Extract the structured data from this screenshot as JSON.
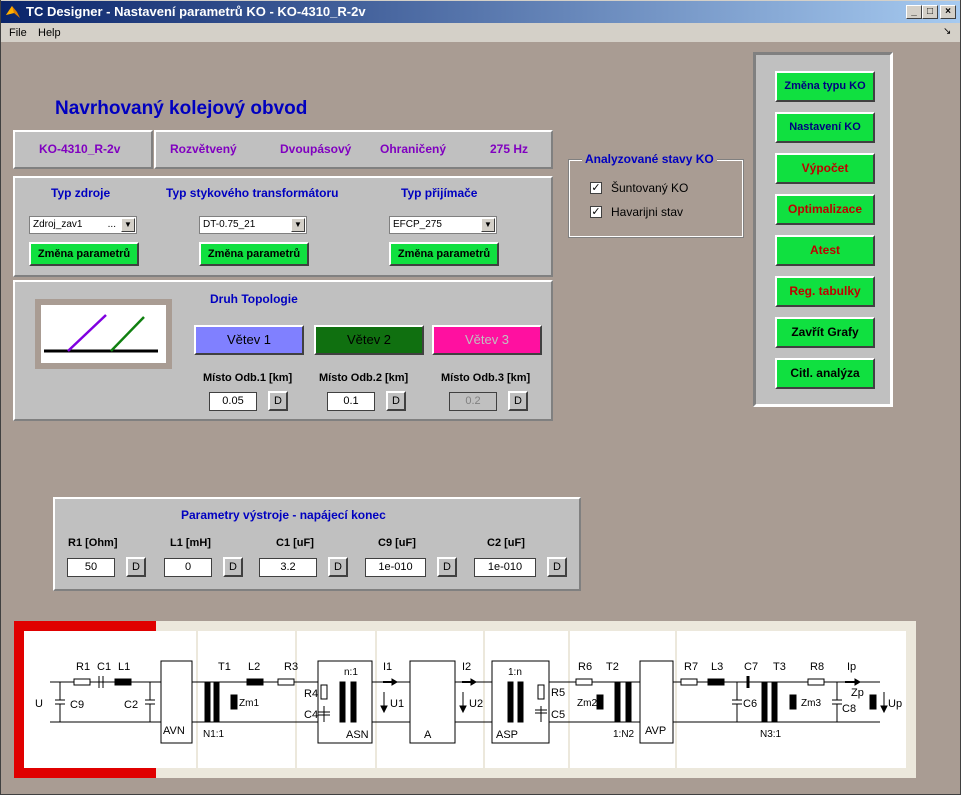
{
  "window": {
    "title": "TC Designer - Nastavení parametrů KO - KO-4310_R-2v",
    "min_glyph": "_",
    "max_glyph": "□",
    "close_glyph": "×"
  },
  "menu": {
    "file": "File",
    "help": "Help",
    "dock_glyph": "↘"
  },
  "header": {
    "title": "Navrhovaný kolejový obvod",
    "name": "KO-4310_R-2v",
    "type": "Rozvětvený",
    "bands": "Dvoupásový",
    "bounded": "Ohraničený",
    "frequency": "275 Hz"
  },
  "sources": {
    "zdroj_title": "Typ zdroje",
    "zdroj_value": "Zdroj_zav1",
    "zdroj_dots": "...",
    "traf_title": "Typ stykového transformátoru",
    "traf_value": "DT-0.75_21",
    "prij_title": "Typ přijímače",
    "prij_value": "EFCP_275",
    "change_label": "Změna parametrů"
  },
  "topology": {
    "title": "Druh Topologie",
    "branches": [
      {
        "label": "Větev 1",
        "bg": "#8080ff",
        "fg": "#000000"
      },
      {
        "label": "Větev 2",
        "bg": "#107010",
        "fg": "#000000"
      },
      {
        "label": "Větev 3",
        "bg": "#ff10a0",
        "fg": "#c0c0c0"
      }
    ],
    "positions": [
      {
        "label": "Místo Odb.1 [km]",
        "value": "0.05",
        "disabled": false
      },
      {
        "label": "Místo Odb.2 [km]",
        "value": "0.1",
        "disabled": false
      },
      {
        "label": "Místo Odb.3 [km]",
        "value": "0.2",
        "disabled": true
      }
    ],
    "d_label": "D"
  },
  "analysis": {
    "title": "Analyzované stavy KO",
    "items": [
      {
        "label": "Šuntovaný KO",
        "checked": true
      },
      {
        "label": "Havarijni stav",
        "checked": true
      }
    ],
    "check_glyph": "✓"
  },
  "actions": [
    {
      "label": "Změna typu KO",
      "color": "#000080"
    },
    {
      "label": "Nastavení KO",
      "color": "#000080"
    },
    {
      "label": "Výpočet",
      "color": "#c00000"
    },
    {
      "label": "Optimalizace",
      "color": "#c00000"
    },
    {
      "label": "Atest",
      "color": "#c00000"
    },
    {
      "label": "Reg. tabulky",
      "color": "#c00000"
    },
    {
      "label": "Zavřít Grafy",
      "color": "#000000"
    },
    {
      "label": "Citl. analýza",
      "color": "#000000"
    }
  ],
  "params": {
    "title": "Parametry výstroje - napájecí konec",
    "fields": [
      {
        "label": "R1 [Ohm]",
        "value": "50"
      },
      {
        "label": "L1 [mH]",
        "value": "0"
      },
      {
        "label": "C1 [uF]",
        "value": "3.2"
      },
      {
        "label": "C9 [uF]",
        "value": "1e-010"
      },
      {
        "label": "C2 [uF]",
        "value": "1e-010"
      }
    ],
    "d_label": "D"
  },
  "circuit": {
    "labels": {
      "U": "U",
      "C9": "C9",
      "R1": "R1",
      "C1": "C1",
      "L1": "L1",
      "C2": "C2",
      "AVN": "AVN",
      "T1": "T1",
      "N1": "N1:1",
      "Zm1": "Zm1",
      "L2": "L2",
      "R3": "R3",
      "R4": "R4",
      "C4": "C4",
      "n1": "n:1",
      "ASN": "ASN",
      "I1": "I1",
      "U1": "U1",
      "A": "A",
      "I2": "I2",
      "U2": "U2",
      "onen": "1:n",
      "ASP": "ASP",
      "R5": "R5",
      "C5": "C5",
      "R6": "R6",
      "T2": "T2",
      "Zm2": "Zm2",
      "N2": "1:N2",
      "AVP": "AVP",
      "R7": "R7",
      "L3": "L3",
      "C7": "C7",
      "C6": "C6",
      "T3": "T3",
      "N3": "N3:1",
      "R8": "R8",
      "Zm3": "Zm3",
      "C8": "C8",
      "Ip": "Ip",
      "Zp": "Zp",
      "Up": "Up"
    }
  }
}
